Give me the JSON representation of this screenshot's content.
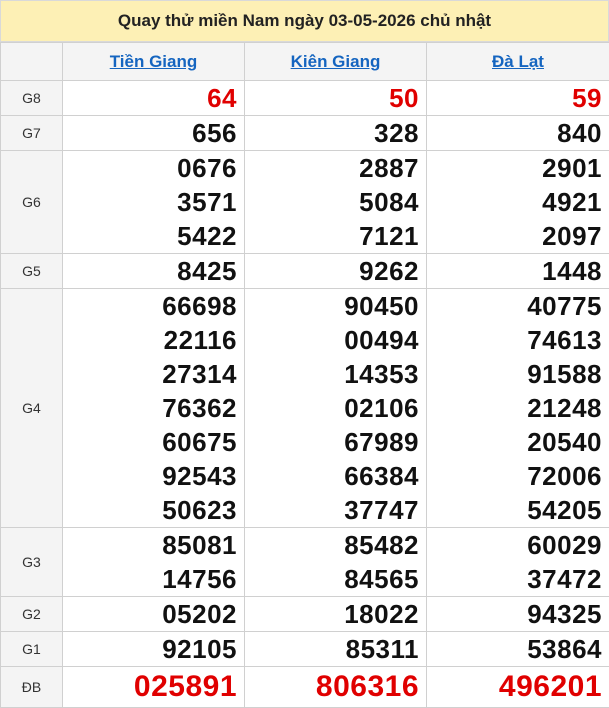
{
  "title": "Quay thử miền Nam ngày 03-05-2026 chủ nhật",
  "provinces": [
    "Tiền Giang",
    "Kiên Giang",
    "Đà Lạt"
  ],
  "prizes": [
    {
      "label": "G8",
      "values": [
        [
          "64"
        ],
        [
          "50"
        ],
        [
          "59"
        ]
      ]
    },
    {
      "label": "G7",
      "values": [
        [
          "656"
        ],
        [
          "328"
        ],
        [
          "840"
        ]
      ]
    },
    {
      "label": "G6",
      "values": [
        [
          "0676",
          "3571",
          "5422"
        ],
        [
          "2887",
          "5084",
          "7121"
        ],
        [
          "2901",
          "4921",
          "2097"
        ]
      ]
    },
    {
      "label": "G5",
      "values": [
        [
          "8425"
        ],
        [
          "9262"
        ],
        [
          "1448"
        ]
      ]
    },
    {
      "label": "G4",
      "values": [
        [
          "66698",
          "22116",
          "27314",
          "76362",
          "60675",
          "92543",
          "50623"
        ],
        [
          "90450",
          "00494",
          "14353",
          "02106",
          "67989",
          "66384",
          "37747"
        ],
        [
          "40775",
          "74613",
          "91588",
          "21248",
          "20540",
          "72006",
          "54205"
        ]
      ]
    },
    {
      "label": "G3",
      "values": [
        [
          "85081",
          "14756"
        ],
        [
          "85482",
          "84565"
        ],
        [
          "60029",
          "37472"
        ]
      ]
    },
    {
      "label": "G2",
      "values": [
        [
          "05202"
        ],
        [
          "18022"
        ],
        [
          "94325"
        ]
      ]
    },
    {
      "label": "G1",
      "values": [
        [
          "92105"
        ],
        [
          "85311"
        ],
        [
          "53864"
        ]
      ]
    },
    {
      "label": "ĐB",
      "values": [
        [
          "025891"
        ],
        [
          "806316"
        ],
        [
          "496201"
        ]
      ]
    }
  ],
  "colors": {
    "header_bg": "#fdf0b5",
    "province_link": "#1565c0",
    "highlight": "#e00000"
  }
}
